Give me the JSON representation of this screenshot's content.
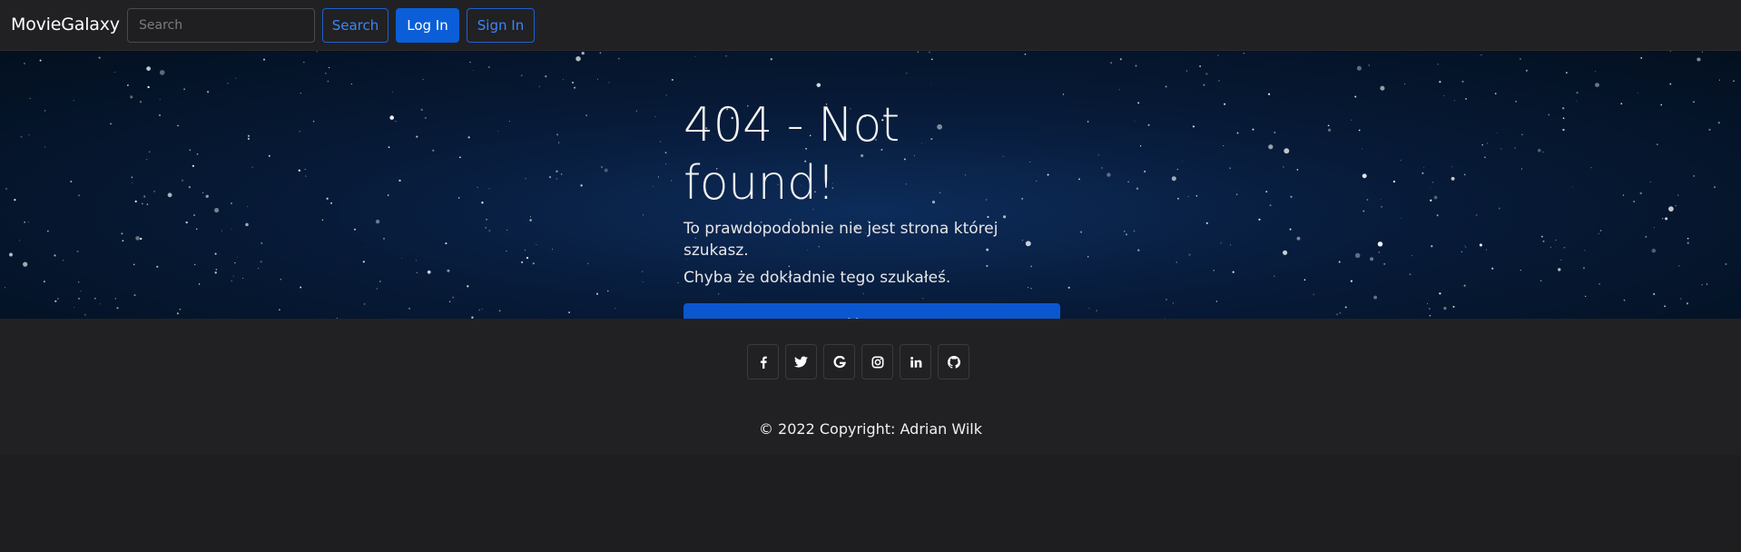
{
  "navbar": {
    "brand": "MovieGalaxy",
    "search_placeholder": "Search",
    "search_button": "Search",
    "login_button": "Log In",
    "signin_button": "Sign In"
  },
  "hero": {
    "title": "404 - Not found!",
    "line1": "To prawdopodobnie nie jest strona której szukasz.",
    "line2": "Chyba że dokładnie tego szukałeś.",
    "home_button": "Home"
  },
  "footer": {
    "social": [
      {
        "icon": "facebook-icon"
      },
      {
        "icon": "twitter-icon"
      },
      {
        "icon": "google-icon"
      },
      {
        "icon": "instagram-icon"
      },
      {
        "icon": "linkedin-icon"
      },
      {
        "icon": "github-icon"
      }
    ],
    "copyright": "© 2022 Copyright: Adrian Wilk"
  },
  "colors": {
    "accent": "#0b5ed7",
    "background": "#1e1e20",
    "navbar": "#212123"
  }
}
